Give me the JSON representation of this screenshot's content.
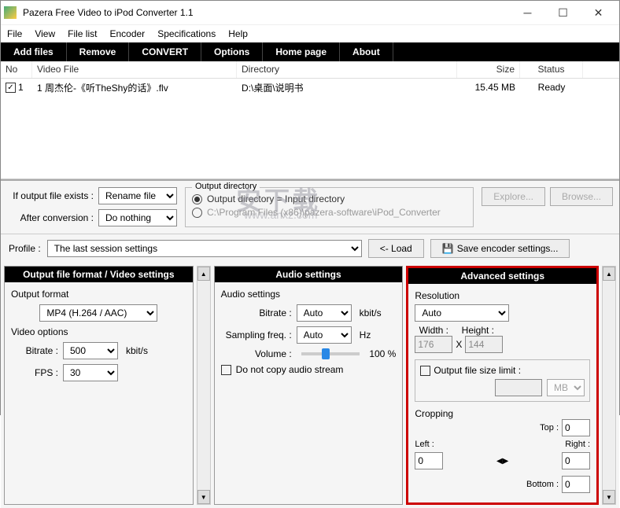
{
  "window": {
    "title": "Pazera Free Video to iPod Converter 1.1"
  },
  "menu": [
    "File",
    "View",
    "File list",
    "Encoder",
    "Specifications",
    "Help"
  ],
  "toolbar": [
    "Add files",
    "Remove",
    "CONVERT",
    "Options",
    "Home page",
    "About"
  ],
  "list": {
    "headers": {
      "no": "No",
      "file": "Video File",
      "dir": "Directory",
      "size": "Size",
      "status": "Status"
    },
    "rows": [
      {
        "checked": true,
        "no": "1",
        "file": "1 周杰伦-《听TheShy的话》.flv",
        "dir": "D:\\桌面\\说明书",
        "size": "15.45 MB",
        "status": "Ready"
      }
    ]
  },
  "mid": {
    "if_exists_label": "If output file exists :",
    "if_exists_value": "Rename file",
    "after_label": "After conversion :",
    "after_value": "Do nothing",
    "outdir_legend": "Output directory",
    "outdir_opt1": "Output directory = Input directory",
    "outdir_opt2": "C:\\Program Files (x86)\\pazera-software\\iPod_Converter",
    "explore": "Explore...",
    "browse": "Browse..."
  },
  "profile": {
    "label": "Profile :",
    "value": "The last session settings",
    "load": "<- Load",
    "save": "Save encoder settings..."
  },
  "panel_output": {
    "title": "Output file format / Video settings",
    "format_label": "Output format",
    "format_value": "MP4 (H.264 / AAC)",
    "video_label": "Video options",
    "bitrate_label": "Bitrate :",
    "bitrate_value": "500",
    "bitrate_unit": "kbit/s",
    "fps_label": "FPS :",
    "fps_value": "30"
  },
  "panel_audio": {
    "title": "Audio settings",
    "sub": "Audio settings",
    "bitrate_label": "Bitrate :",
    "bitrate_value": "Auto",
    "bitrate_unit": "kbit/s",
    "sampling_label": "Sampling freq. :",
    "sampling_value": "Auto",
    "sampling_unit": "Hz",
    "volume_label": "Volume :",
    "volume_value": "100 %",
    "nocopy": "Do not copy audio stream"
  },
  "panel_adv": {
    "title": "Advanced settings",
    "resolution": "Resolution",
    "res_value": "Auto",
    "width_label": "Width :",
    "width_value": "176",
    "height_label": "Height :",
    "height_value": "144",
    "limit_label": "Output file size limit :",
    "limit_unit": "MB",
    "crop": "Cropping",
    "top": "Top :",
    "left": "Left :",
    "right": "Right :",
    "bottom": "Bottom :",
    "zero": "0"
  },
  "watermark": "安下载",
  "watermark_url": "www.anxz.com"
}
